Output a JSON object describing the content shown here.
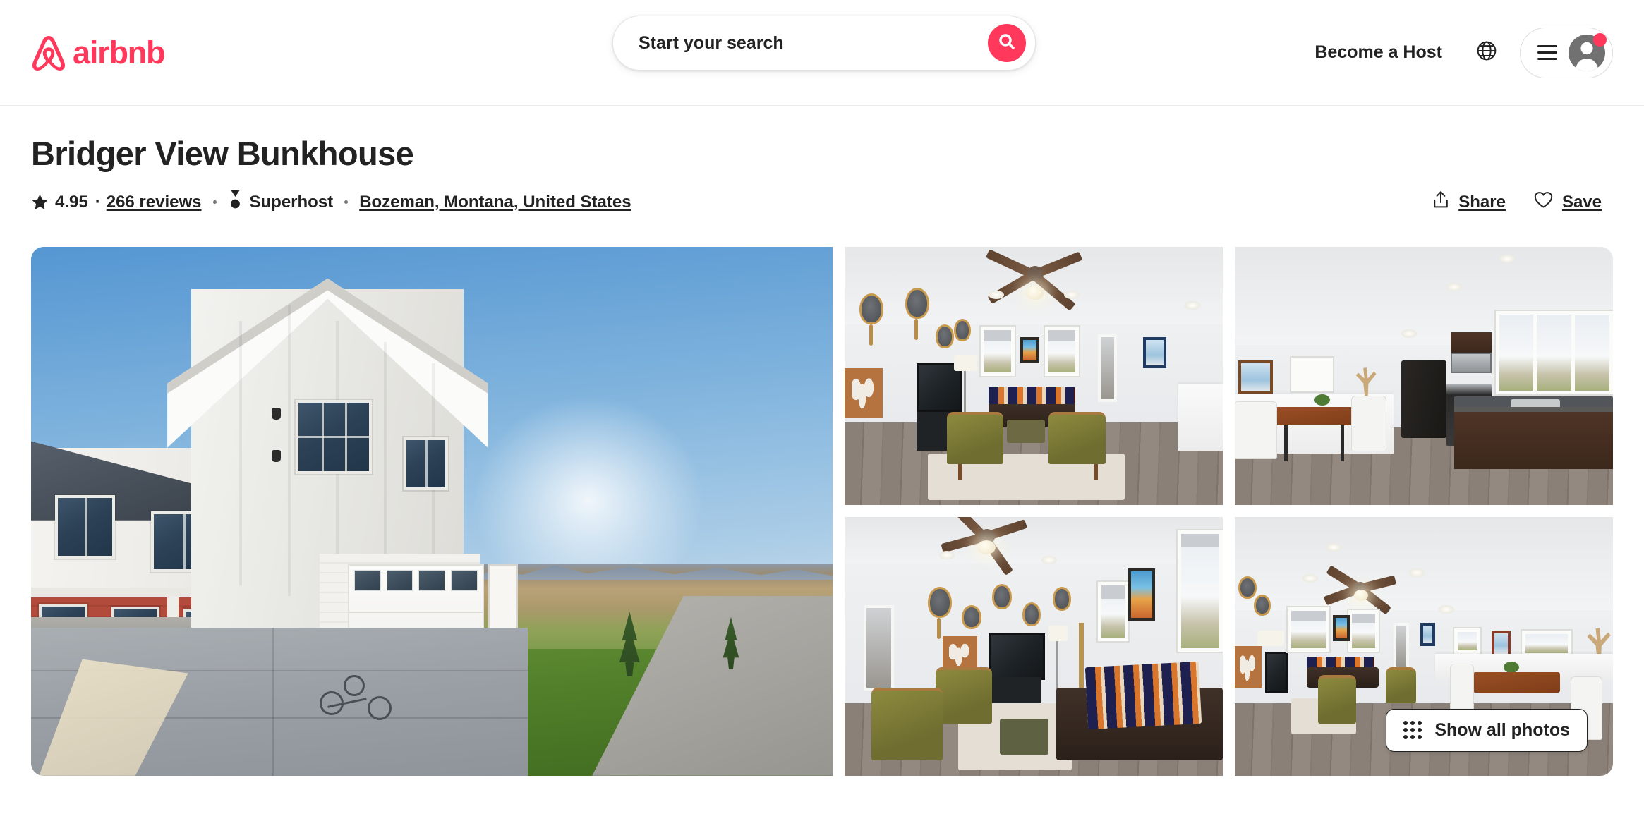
{
  "header": {
    "brand_name": "airbnb",
    "brand_color": "#FF385C",
    "search": {
      "placeholder": "Start your search",
      "value": "Start your search",
      "icon": "search-icon"
    },
    "become_a_host": "Become a Host",
    "globe_icon": "globe-icon",
    "menu_icon": "hamburger-menu-icon",
    "avatar_icon": "user-avatar-icon",
    "has_notification": true
  },
  "listing": {
    "title": "Bridger View Bunkhouse",
    "rating": "4.95",
    "star_icon": "star-icon",
    "separator": "·",
    "reviews_label": "266 reviews",
    "review_count": 266,
    "superhost_icon": "superhost-medal-icon",
    "superhost_label": "Superhost",
    "location": "Bozeman, Montana, United States"
  },
  "actions": {
    "share_icon": "share-icon",
    "share_label": "Share",
    "save_icon": "heart-icon",
    "save_label": "Save"
  },
  "gallery": {
    "show_all_label": "Show all photos",
    "show_all_icon": "grid-dots-icon",
    "photos": [
      {
        "position": "hero",
        "alt": "Exterior of white board-and-batten bunkhouse with garage, driveway and bicycles"
      },
      {
        "position": "top-middle",
        "alt": "Living room with ceiling fan, olive armchairs and leather bench"
      },
      {
        "position": "top-right",
        "alt": "Kitchen with dark wood cabinets, black refrigerator and dining table"
      },
      {
        "position": "bottom-middle",
        "alt": "Living room with fly-fishing nets on wall, TV and patterned blanket"
      },
      {
        "position": "bottom-right",
        "alt": "Open plan great room with vaulted ceiling and dining area"
      }
    ]
  }
}
